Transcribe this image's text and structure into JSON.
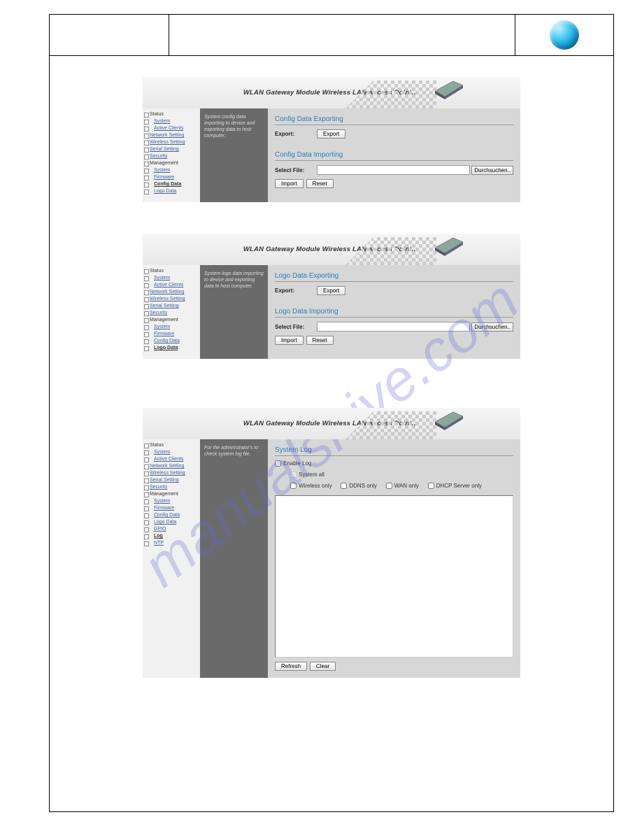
{
  "watermark": "manualshive.com",
  "header_title": "WLAN Gateway Module Wireless LAN Access Point....",
  "browse_label": "Durchsuchen..",
  "buttons": {
    "export": "Export",
    "import": "Import",
    "reset": "Reset",
    "refresh": "Refresh",
    "clear": "Clear"
  },
  "labels": {
    "export": "Export:",
    "select_file": "Select File:"
  },
  "shot1": {
    "help": "System config data importing to device and exporting data to host computer.",
    "t1": "Config Data Exporting",
    "t2": "Config Data Importing",
    "nav": [
      "Status",
      "System",
      "Active Clients",
      "Network Setting",
      "Wireless Setting",
      "Serial Setting",
      "Security",
      "Management",
      "System",
      "Firmware",
      "Config Data",
      "Logo Data"
    ],
    "active": "Config Data"
  },
  "shot2": {
    "help": "System logo data importing to device and exporting data to host computer.",
    "t1": "Logo Data Exporting",
    "t2": "Logo Data Importing",
    "nav": [
      "Status",
      "System",
      "Active Clients",
      "Network Setting",
      "Wireless Setting",
      "Serial Setting",
      "Security",
      "Management",
      "System",
      "Firmware",
      "Config Data",
      "Logo Data"
    ],
    "active": "Logo Data"
  },
  "shot3": {
    "help": "For the administrator's to check system log file.",
    "t1": "System Log",
    "enable": "Enable Log",
    "sysall": "System all",
    "opts": [
      "Wireless only",
      "DDNS only",
      "WAN only",
      "DHCP Server only"
    ],
    "nav": [
      "Status",
      "System",
      "Active Clients",
      "Network Setting",
      "Wireless Setting",
      "Serial Setting",
      "Security",
      "Management",
      "System",
      "Firmware",
      "Config Data",
      "Logo Data",
      "GPIO",
      "Log",
      "NTP"
    ],
    "active": "Log"
  }
}
